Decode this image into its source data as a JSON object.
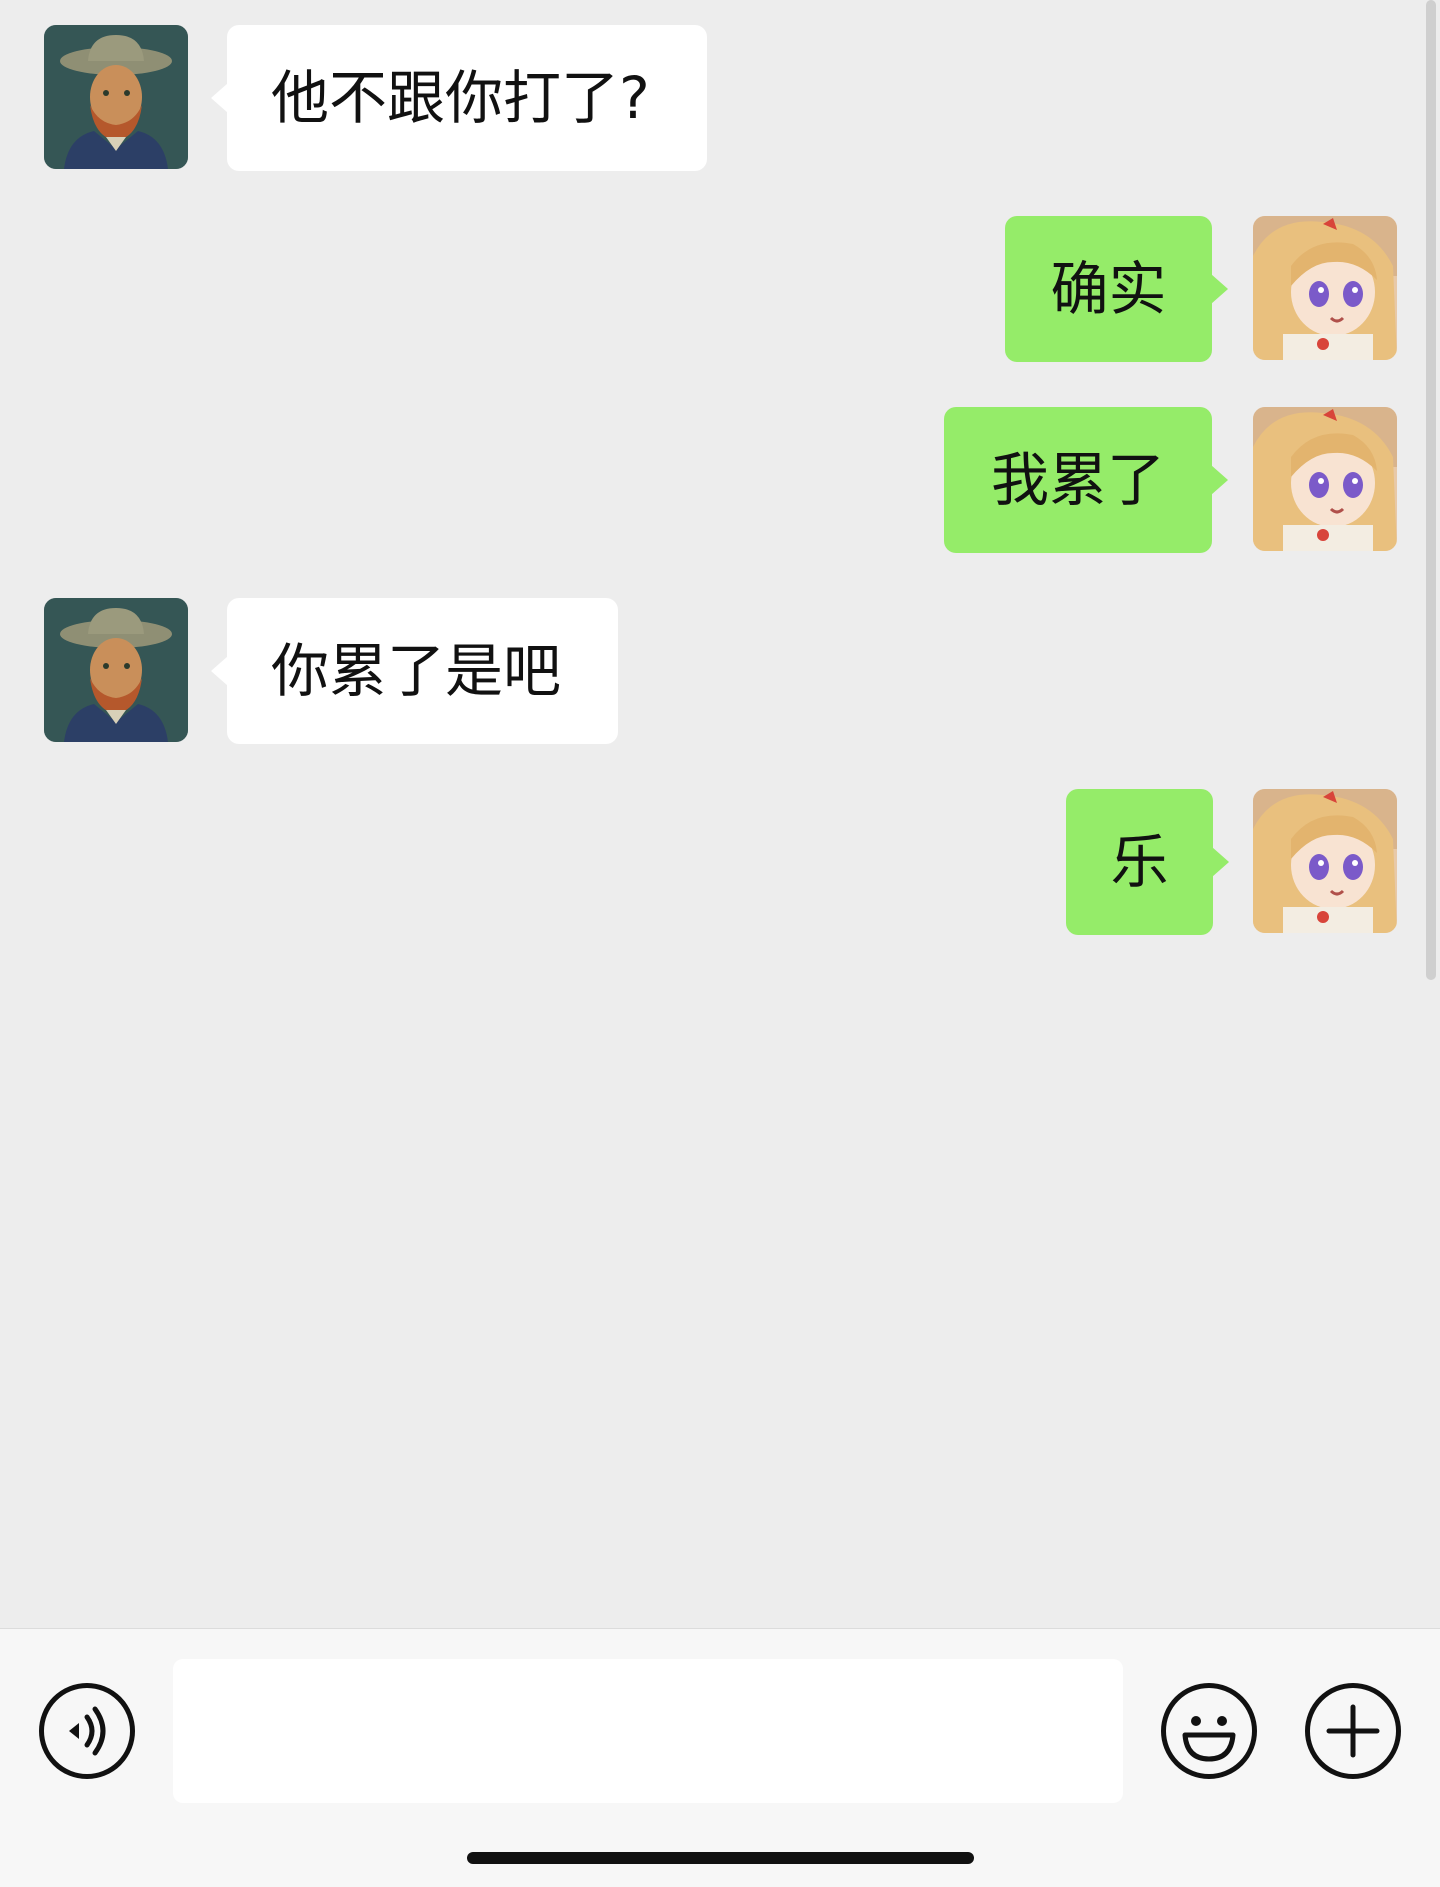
{
  "messages": [
    {
      "side": "received",
      "text": "他不跟你打了?",
      "avatar": "van-gogh-portrait"
    },
    {
      "side": "sent",
      "text": "确实",
      "avatar": "anime-girl"
    },
    {
      "side": "sent",
      "text": "我累了",
      "avatar": "anime-girl"
    },
    {
      "side": "received",
      "text": "你累了是吧",
      "avatar": "van-gogh-portrait"
    },
    {
      "side": "sent",
      "text": "乐",
      "avatar": "anime-girl"
    }
  ],
  "input_bar": {
    "voice_icon": "voice-icon",
    "message_value": "",
    "emoji_icon": "emoji-icon",
    "plus_icon": "plus-icon"
  },
  "colors": {
    "background": "#ededed",
    "received_bubble": "#ffffff",
    "sent_bubble": "#95ec69",
    "text": "#111111"
  }
}
